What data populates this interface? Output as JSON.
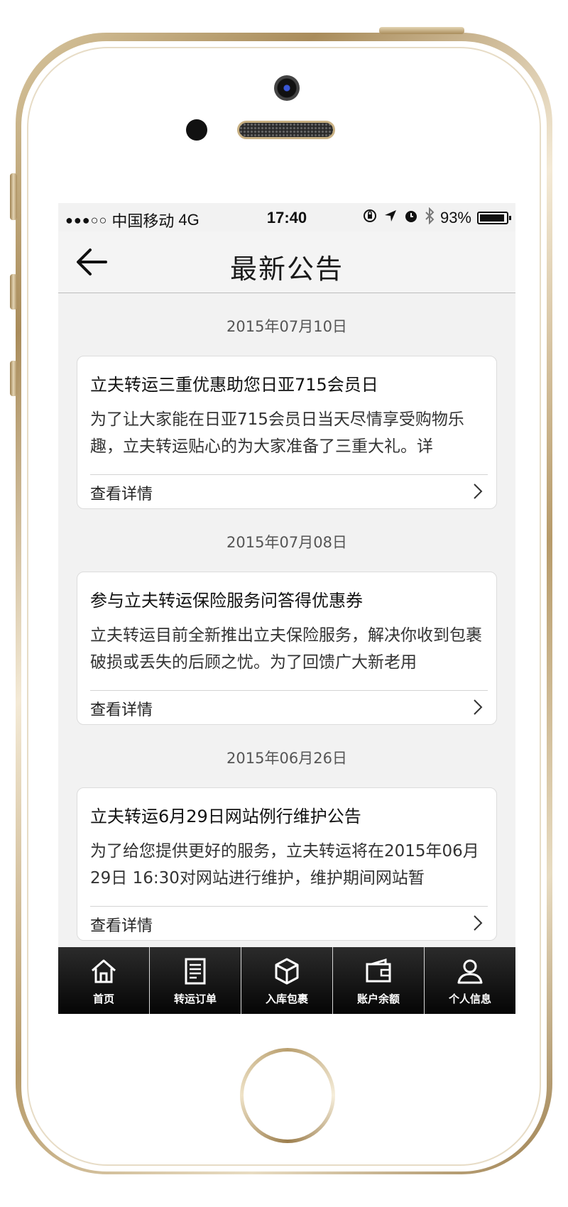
{
  "status_bar": {
    "signal": "●●●○○",
    "carrier": "中国移动",
    "network": "4G",
    "time": "17:40",
    "battery": "93%"
  },
  "nav": {
    "title": "最新公告",
    "back_icon": "arrow-left-icon"
  },
  "notices": [
    {
      "date": "2015年07月10日",
      "title": "立夫转运三重优惠助您日亚715会员日",
      "body": "为了让大家能在日亚715会员日当天尽情享受购物乐趣，立夫转运贴心的为大家准备了三重大礼。详",
      "link": "查看详情"
    },
    {
      "date": "2015年07月08日",
      "title": "参与立夫转运保险服务问答得优惠券",
      "body": "立夫转运目前全新推出立夫保险服务，解决你收到包裹破损或丢失的后顾之忧。为了回馈广大新老用",
      "link": "查看详情"
    },
    {
      "date": "2015年06月26日",
      "title": "立夫转运6月29日网站例行维护公告",
      "body": "为了给您提供更好的服务，立夫转运将在2015年06月29日 16:30对网站进行维护，维护期间网站暂",
      "link": "查看详情"
    }
  ],
  "tabs": [
    {
      "label": "首页",
      "icon": "home-icon"
    },
    {
      "label": "转运订单",
      "icon": "document-icon"
    },
    {
      "label": "入库包裹",
      "icon": "box-icon"
    },
    {
      "label": "账户余额",
      "icon": "wallet-icon"
    },
    {
      "label": "个人信息",
      "icon": "user-icon"
    }
  ]
}
